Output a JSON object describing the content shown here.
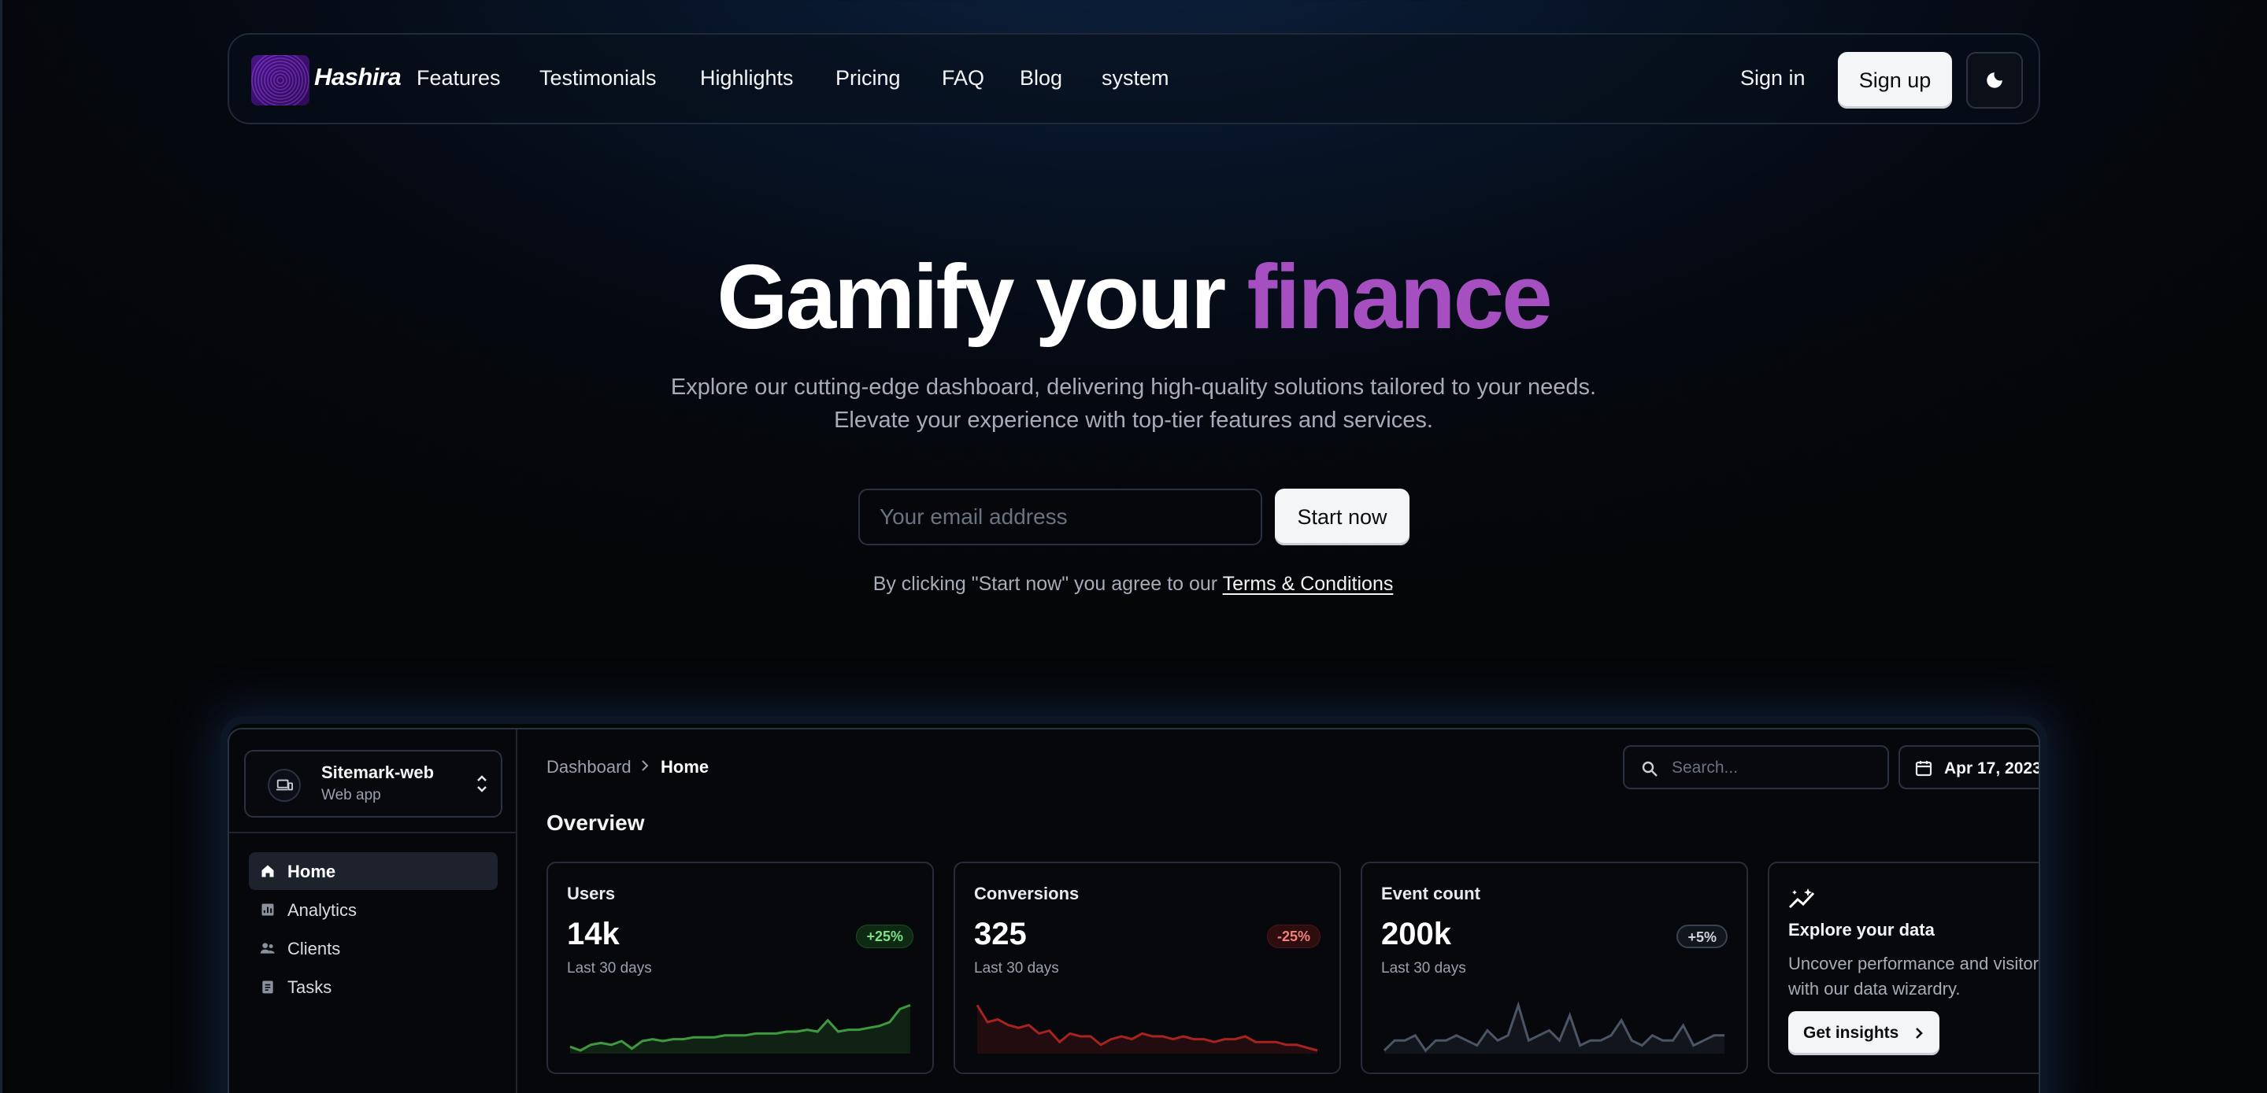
{
  "brand": {
    "name": "Hashira"
  },
  "nav": {
    "links": [
      "Features",
      "Testimonials",
      "Highlights",
      "Pricing",
      "FAQ",
      "Blog",
      "system"
    ],
    "sign_in": "Sign in",
    "sign_up": "Sign up",
    "theme_icon": "moon-icon"
  },
  "hero": {
    "title_main": "Gamify your",
    "title_accent": "finance",
    "subtitle_line1": "Explore our cutting-edge dashboard, delivering high-quality solutions tailored to your needs.",
    "subtitle_line2": "Elevate your experience with top-tier features and services.",
    "email_placeholder": "Your email address",
    "cta": "Start now",
    "terms_prefix": "By clicking \"Start now\" you agree to our",
    "terms_link": "Terms & Conditions",
    "terms_suffix": "."
  },
  "colors": {
    "accent": "#a54fc0",
    "up": "#7ee08a",
    "down": "#f0807a"
  },
  "dashboard": {
    "site": {
      "name": "Sitemark-web",
      "sub": "Web app"
    },
    "menu": [
      {
        "label": "Home",
        "icon": "home-icon",
        "active": true
      },
      {
        "label": "Analytics",
        "icon": "analytics-icon",
        "active": false
      },
      {
        "label": "Clients",
        "icon": "people-icon",
        "active": false
      },
      {
        "label": "Tasks",
        "icon": "clipboard-icon",
        "active": false
      }
    ],
    "breadcrumb": {
      "parent": "Dashboard",
      "current": "Home"
    },
    "search_placeholder": "Search...",
    "date": "Apr 17, 2023",
    "section_title": "Overview",
    "cards": [
      {
        "title": "Users",
        "value": "14k",
        "badge": "+25%",
        "trend": "up",
        "period": "Last 30 days",
        "series": [
          4,
          2,
          5,
          6,
          5,
          7,
          3,
          7,
          8,
          7,
          8,
          8,
          9,
          9,
          9,
          10,
          10,
          10,
          11,
          11,
          11,
          12,
          12,
          13,
          12,
          18,
          12,
          13,
          13,
          14,
          15,
          17,
          24,
          26
        ]
      },
      {
        "title": "Conversions",
        "value": "325",
        "badge": "-25%",
        "trend": "down",
        "period": "Last 30 days",
        "series": [
          22,
          16,
          17,
          15,
          14,
          15,
          12,
          13,
          9,
          12,
          11,
          11,
          8,
          10,
          11,
          10,
          12,
          11,
          11,
          10,
          11,
          10,
          10,
          9,
          10,
          10,
          11,
          9,
          9,
          9,
          8,
          8,
          7,
          6
        ]
      },
      {
        "title": "Event count",
        "value": "200k",
        "badge": "+5%",
        "trend": "neutral",
        "period": "Last 30 days",
        "series": [
          10,
          12,
          12,
          13,
          10,
          12,
          12,
          13,
          12,
          11,
          14,
          12,
          13,
          19,
          12,
          13,
          14,
          12,
          17,
          11,
          12,
          12,
          13,
          16,
          12,
          11,
          13,
          12,
          12,
          15,
          11,
          12,
          13,
          13
        ]
      }
    ],
    "explore": {
      "title": "Explore your data",
      "desc": "Uncover performance and visitor insights with our data wizardry.",
      "button": "Get insights"
    }
  }
}
